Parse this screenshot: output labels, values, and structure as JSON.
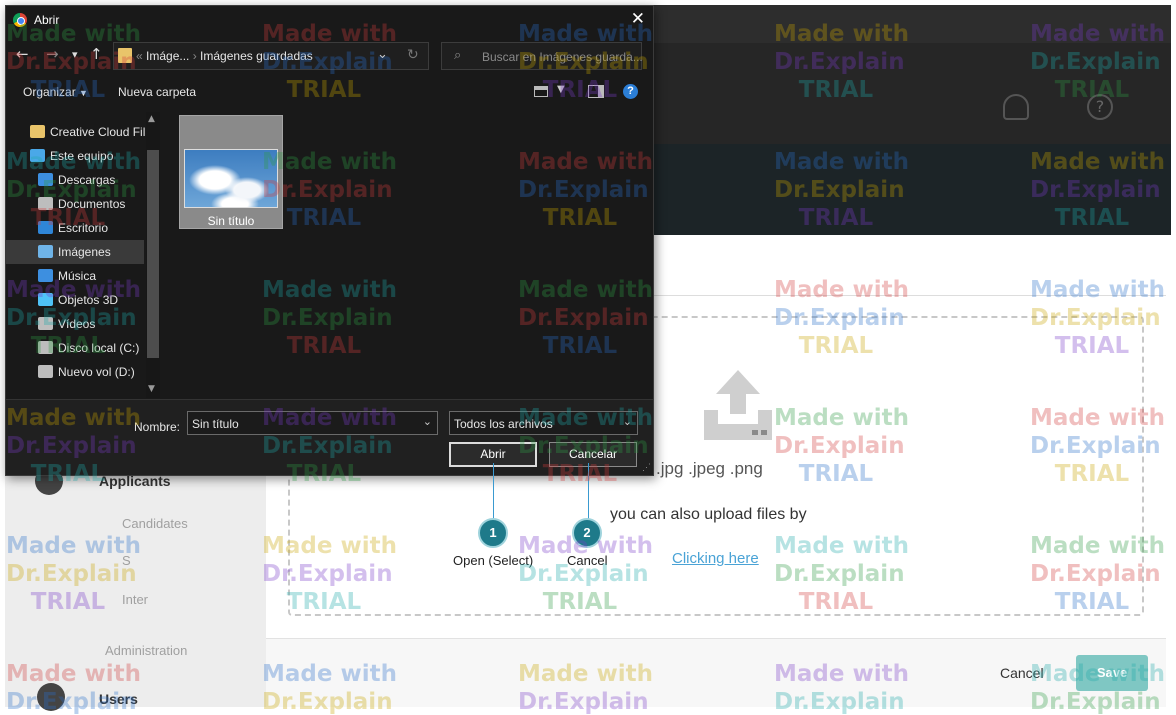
{
  "dialog": {
    "title": "Abrir",
    "address_parts": [
      "Imáge...",
      "Imágenes guardadas"
    ],
    "search_placeholder": "Buscar en Imágenes guarda...",
    "organize_label": "Organizar",
    "new_folder_label": "Nueva carpeta",
    "help_label": "?",
    "nav_items": [
      {
        "label": "Creative Cloud Fil",
        "icon": "creative-cloud-icon",
        "color": "#e9c46a"
      },
      {
        "label": "Este equipo",
        "icon": "computer-icon",
        "color": "#4aa8e8"
      },
      {
        "label": "Descargas",
        "icon": "download-icon",
        "color": "#3d8fe0"
      },
      {
        "label": "Documentos",
        "icon": "document-icon",
        "color": "#bdbdbd"
      },
      {
        "label": "Escritorio",
        "icon": "desktop-icon",
        "color": "#2f86d8"
      },
      {
        "label": "Imágenes",
        "icon": "pictures-icon",
        "color": "#6fb4e8",
        "selected": true
      },
      {
        "label": "Música",
        "icon": "music-icon",
        "color": "#3d8fe0"
      },
      {
        "label": "Objetos 3D",
        "icon": "3d-objects-icon",
        "color": "#4fc3f7"
      },
      {
        "label": "Vídeos",
        "icon": "video-icon",
        "color": "#bdbdbd"
      },
      {
        "label": "Disco local (C:)",
        "icon": "drive-icon",
        "color": "#bdbdbd"
      },
      {
        "label": "Nuevo vol (D:)",
        "icon": "drive-icon",
        "color": "#bdbdbd"
      }
    ],
    "file": {
      "name": "Sin título"
    },
    "name_label": "Nombre:",
    "name_value": "Sin título",
    "file_type": "Todos los archivos",
    "open_button": "Abrir",
    "cancel_button": "Cancelar"
  },
  "callouts": [
    {
      "number": "1",
      "label": "Open (Select)"
    },
    {
      "number": "2",
      "label": "Cancel"
    }
  ],
  "app": {
    "sidebar": {
      "applicants": "Applicants",
      "candidates": "Candidates",
      "item_s": "S",
      "item_inter": "Inter",
      "administration": "Administration",
      "users": "Users"
    },
    "upload": {
      "types": ".jpg .jpeg .png",
      "also": "you can also upload files by",
      "link": "Clicking here"
    },
    "footer": {
      "cancel": "Cancel",
      "save": "Save"
    },
    "header_icons": [
      "bell-icon",
      "help-circle-icon"
    ]
  },
  "watermark": {
    "lines": [
      "Made with",
      "Dr.Explain",
      "TRIAL"
    ],
    "colors": [
      "#2e9b44",
      "#d13b3b",
      "#2a6fc9",
      "#c8a400",
      "#7a3bc8",
      "#1fa9a9"
    ]
  }
}
